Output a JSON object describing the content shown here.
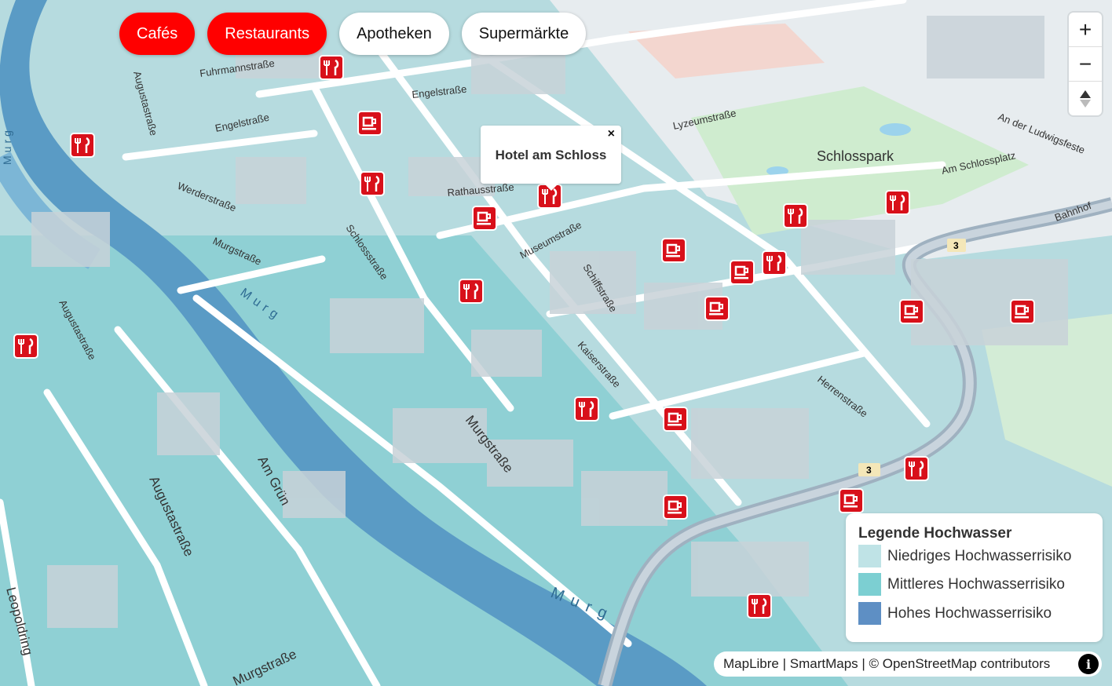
{
  "filters": [
    {
      "label": "Cafés",
      "active": true
    },
    {
      "label": "Restaurants",
      "active": true
    },
    {
      "label": "Apotheken",
      "active": false
    },
    {
      "label": "Supermärkte",
      "active": false
    }
  ],
  "controls": {
    "zoom_in": "+",
    "zoom_out": "−",
    "compass": "compass"
  },
  "popup": {
    "title": "Hotel am Schloss",
    "close": "×"
  },
  "legend": {
    "title": "Legende Hochwasser",
    "items": [
      {
        "label": "Niedriges Hochwasserrisiko",
        "color": "#bfe3e6"
      },
      {
        "label": "Mittleres Hochwasserrisiko",
        "color": "#7ccfd2"
      },
      {
        "label": "Hohes Hochwasserrisiko",
        "color": "#5e8fc4"
      }
    ]
  },
  "attribution": "MapLibre | SmartMaps | © OpenStreetMap contributors",
  "attribution_icon": "i",
  "map": {
    "park_label": "Schlosspark",
    "river_label": "Murg",
    "road_shield": "3",
    "streets": [
      "Fuhrmannstraße",
      "Engelstraße",
      "Werderstraße",
      "Rathausstraße",
      "Schlossstraße",
      "Murgstraße",
      "Museumstraße",
      "Schiffstraße",
      "Kaiserstraße",
      "Herrenstraße",
      "Augustastraße",
      "Am Grün",
      "Leopoldring",
      "Lyzeumstraße",
      "Am Schlossplatz",
      "An der Ludwigsfeste",
      "Bahnhof",
      "Murgstraße",
      "Augustastraße",
      "Murgstraße",
      "Augustastraße",
      "Engelstraße"
    ],
    "poi_icons": {
      "cafe": "cafe-icon",
      "restaurant": "restaurant-icon"
    }
  }
}
